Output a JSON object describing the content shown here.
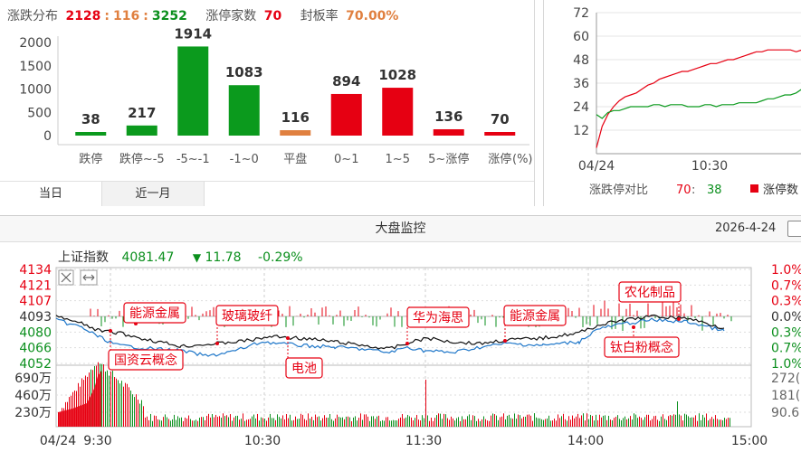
{
  "distribution": {
    "title": "涨跌分布",
    "up_count": "2128",
    "flat_count": "116",
    "down_count": "3252",
    "sep": ":",
    "limit_up_label": "涨停家数",
    "limit_up_value": "70",
    "seal_rate_label": "封板率",
    "seal_rate_value": "70.00%",
    "unit": "(%)",
    "y_ticks": [
      "2000",
      "1500",
      "1000",
      "500",
      "0"
    ],
    "tabs": [
      "当日",
      "近一月"
    ]
  },
  "chart_data": [
    {
      "type": "bar",
      "categories": [
        "跌停",
        "跌停~-5",
        "-5~-1",
        "-1~0",
        "平盘",
        "0~1",
        "1~5",
        "5~涨停",
        "涨停"
      ],
      "values": [
        38,
        217,
        1914,
        1083,
        116,
        894,
        1028,
        136,
        70
      ],
      "colors": [
        "#0b9a1d",
        "#0b9a1d",
        "#0b9a1d",
        "#0b9a1d",
        "#e08040",
        "#e60012",
        "#e60012",
        "#e60012",
        "#e60012"
      ],
      "ylim": [
        0,
        2000
      ]
    },
    {
      "type": "line",
      "y_ticks": [
        72,
        60,
        48,
        36,
        24,
        12
      ],
      "x_ticks": [
        "04/24",
        "10:30"
      ],
      "ylim": [
        0,
        72
      ],
      "series": [
        {
          "color": "#e60012",
          "values": [
            3,
            14,
            20,
            24,
            27,
            29,
            30,
            31,
            33,
            35,
            36,
            38,
            39,
            40,
            41,
            42,
            42,
            43,
            44,
            45,
            46,
            46,
            47,
            48,
            48,
            49,
            50,
            51,
            52,
            52,
            53,
            53,
            53,
            53,
            53,
            52,
            53
          ]
        },
        {
          "color": "#0b9a1d",
          "values": [
            20,
            18,
            21,
            22,
            22,
            23,
            24,
            24,
            24,
            24,
            25,
            25,
            24,
            25,
            25,
            25,
            24,
            24,
            24,
            25,
            25,
            24,
            25,
            25,
            25,
            26,
            26,
            26,
            26,
            27,
            28,
            28,
            29,
            30,
            30,
            31,
            33
          ]
        }
      ],
      "legend_label": "涨跌停对比",
      "legend_value": "70 : 38",
      "legend_series": "涨停数"
    }
  ],
  "ratio_legend": {
    "label": "涨跌停对比",
    "value_up": "70",
    "sep": " : ",
    "value_down": "38",
    "series": "涨停数"
  },
  "banner": {
    "title": "大盘监控",
    "date": "2026-4-24"
  },
  "index": {
    "name": "上证指数",
    "value": "4081.47",
    "arrow": "▼",
    "change": "11.78",
    "pct": "-0.29%",
    "y_left": [
      "4134",
      "4121",
      "4107",
      "4093",
      "4080",
      "4066",
      "4052"
    ],
    "y_right": [
      "1.0%",
      "0.7%",
      "0.3%",
      "0.0%",
      "0.3%",
      "0.7%",
      "1.0%"
    ],
    "vol_left": [
      "690万",
      "460万",
      "230万"
    ],
    "vol_right": [
      "272(",
      "181(",
      "90.6"
    ],
    "x_ticks": [
      "04/24",
      "9:30",
      "10:30",
      "11:30",
      "14:00",
      "15:00"
    ],
    "annotations": [
      "能源金属",
      "玻璃玻纤",
      "华为海思",
      "能源金属",
      "农化制品",
      "国资云概念",
      "电池",
      "钛白粉概念"
    ]
  },
  "colors": {
    "up": "#e60012",
    "down": "#0b8f1d",
    "flat": "#e08040",
    "blue_line": "#1f77c9"
  }
}
